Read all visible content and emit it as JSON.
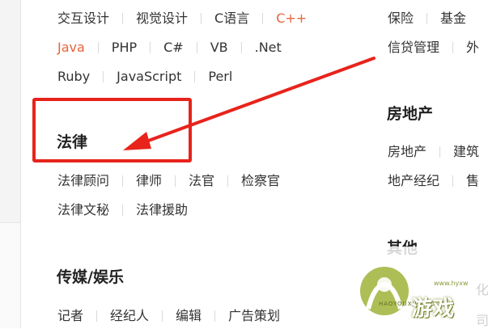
{
  "colors": {
    "accent": "#e8643c",
    "highlight": "#e8231b",
    "text": "#333333",
    "heading": "#222222",
    "separator": "#d9d9d9"
  },
  "left_column": {
    "programming": {
      "rows": [
        [
          {
            "label": "交互设计",
            "hot": false
          },
          {
            "label": "视觉设计",
            "hot": false
          },
          {
            "label": "C语言",
            "hot": false
          },
          {
            "label": "C++",
            "hot": true
          }
        ],
        [
          {
            "label": "Java",
            "hot": true
          },
          {
            "label": "PHP",
            "hot": false
          },
          {
            "label": "C#",
            "hot": false
          },
          {
            "label": "VB",
            "hot": false
          },
          {
            "label": ".Net",
            "hot": false
          }
        ],
        [
          {
            "label": "Ruby",
            "hot": false
          },
          {
            "label": "JavaScript",
            "hot": false
          },
          {
            "label": "Perl",
            "hot": false
          }
        ]
      ]
    },
    "law": {
      "title": "法律",
      "rows": [
        [
          "法律顾问",
          "律师",
          "法官",
          "检察官"
        ],
        [
          "法律文秘",
          "法律援助"
        ]
      ]
    },
    "media": {
      "title": "传媒/娱乐",
      "rows": [
        [
          "记者",
          "经纪人",
          "编辑",
          "广告策划"
        ]
      ]
    }
  },
  "right_column": {
    "finance": {
      "rows": [
        [
          "保险",
          "基金"
        ],
        [
          "信贷管理",
          "外"
        ]
      ]
    },
    "realestate": {
      "title": "房地产",
      "rows": [
        [
          "房地产",
          "建筑"
        ],
        [
          "地产经纪",
          "售"
        ]
      ]
    },
    "other": {
      "title": "其他",
      "partial": [
        "化",
        "司"
      ]
    }
  },
  "watermark": {
    "text": "游戏",
    "sub": "HAOYOUXIWANG",
    "url": "www.hyxw"
  },
  "icons": {
    "arrow": "red-arrow-icon",
    "watermark": "game-logo-icon"
  }
}
